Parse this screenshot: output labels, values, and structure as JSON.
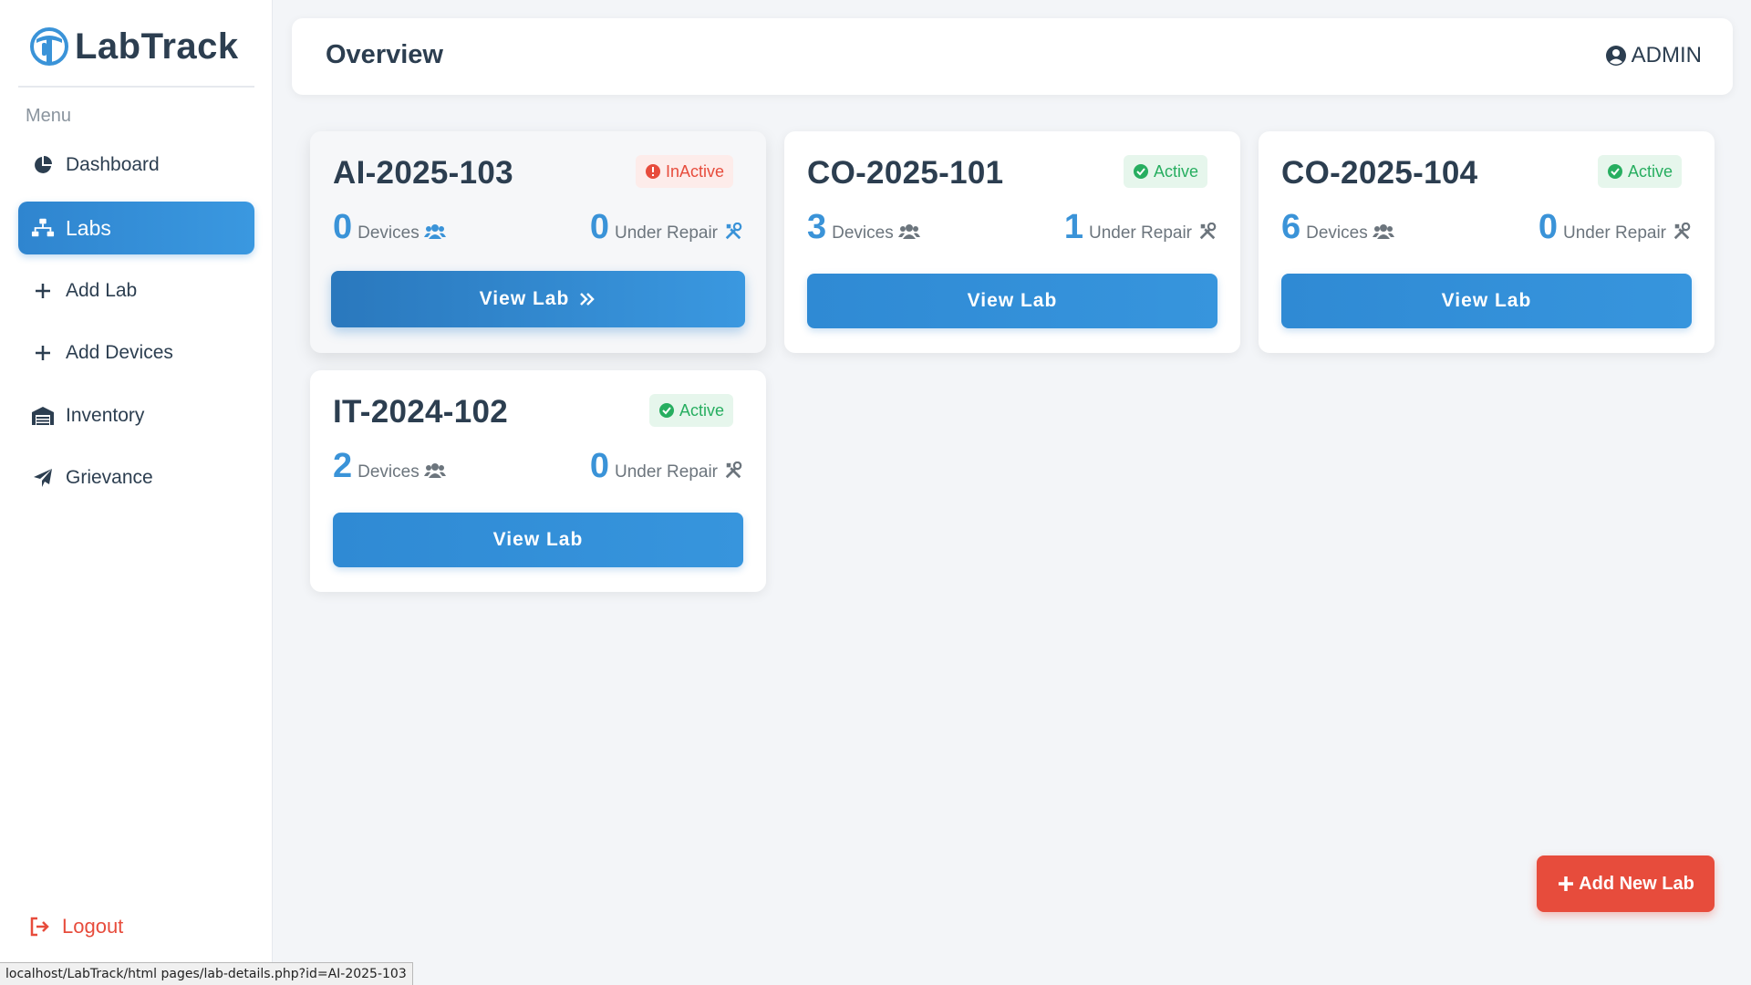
{
  "brand": {
    "name": "LabTrack"
  },
  "sidebar": {
    "menu_heading": "Menu",
    "items": [
      {
        "label": "Dashboard",
        "icon": "pie-chart-icon"
      },
      {
        "label": "Labs",
        "icon": "sitemap-icon",
        "active": true
      },
      {
        "label": "Add Lab",
        "icon": "plus-icon"
      },
      {
        "label": "Add Devices",
        "icon": "plus-icon"
      },
      {
        "label": "Inventory",
        "icon": "warehouse-icon"
      },
      {
        "label": "Grievance",
        "icon": "paper-plane-icon"
      }
    ],
    "logout_label": "Logout"
  },
  "header": {
    "title": "Overview",
    "user_label": "ADMIN"
  },
  "labs": [
    {
      "name": "AI-2025-103",
      "status": "InActive",
      "devices": "0",
      "devices_label": "Devices",
      "repair": "0",
      "repair_label": "Under Repair",
      "button": "View Lab"
    },
    {
      "name": "CO-2025-101",
      "status": "Active",
      "devices": "3",
      "devices_label": "Devices",
      "repair": "1",
      "repair_label": "Under Repair",
      "button": "View Lab"
    },
    {
      "name": "CO-2025-104",
      "status": "Active",
      "devices": "6",
      "devices_label": "Devices",
      "repair": "0",
      "repair_label": "Under Repair",
      "button": "View Lab"
    },
    {
      "name": "IT-2024-102",
      "status": "Active",
      "devices": "2",
      "devices_label": "Devices",
      "repair": "0",
      "repair_label": "Under Repair",
      "button": "View Lab"
    }
  ],
  "fab": {
    "label": "Add New Lab"
  },
  "status_url": "localhost/LabTrack/html pages/lab-details.php?id=AI-2025-103",
  "colors": {
    "accent": "#3a93d8",
    "active_green": "#27ae60",
    "inactive_red": "#e74c3c",
    "text_dark": "#2c3e50"
  }
}
